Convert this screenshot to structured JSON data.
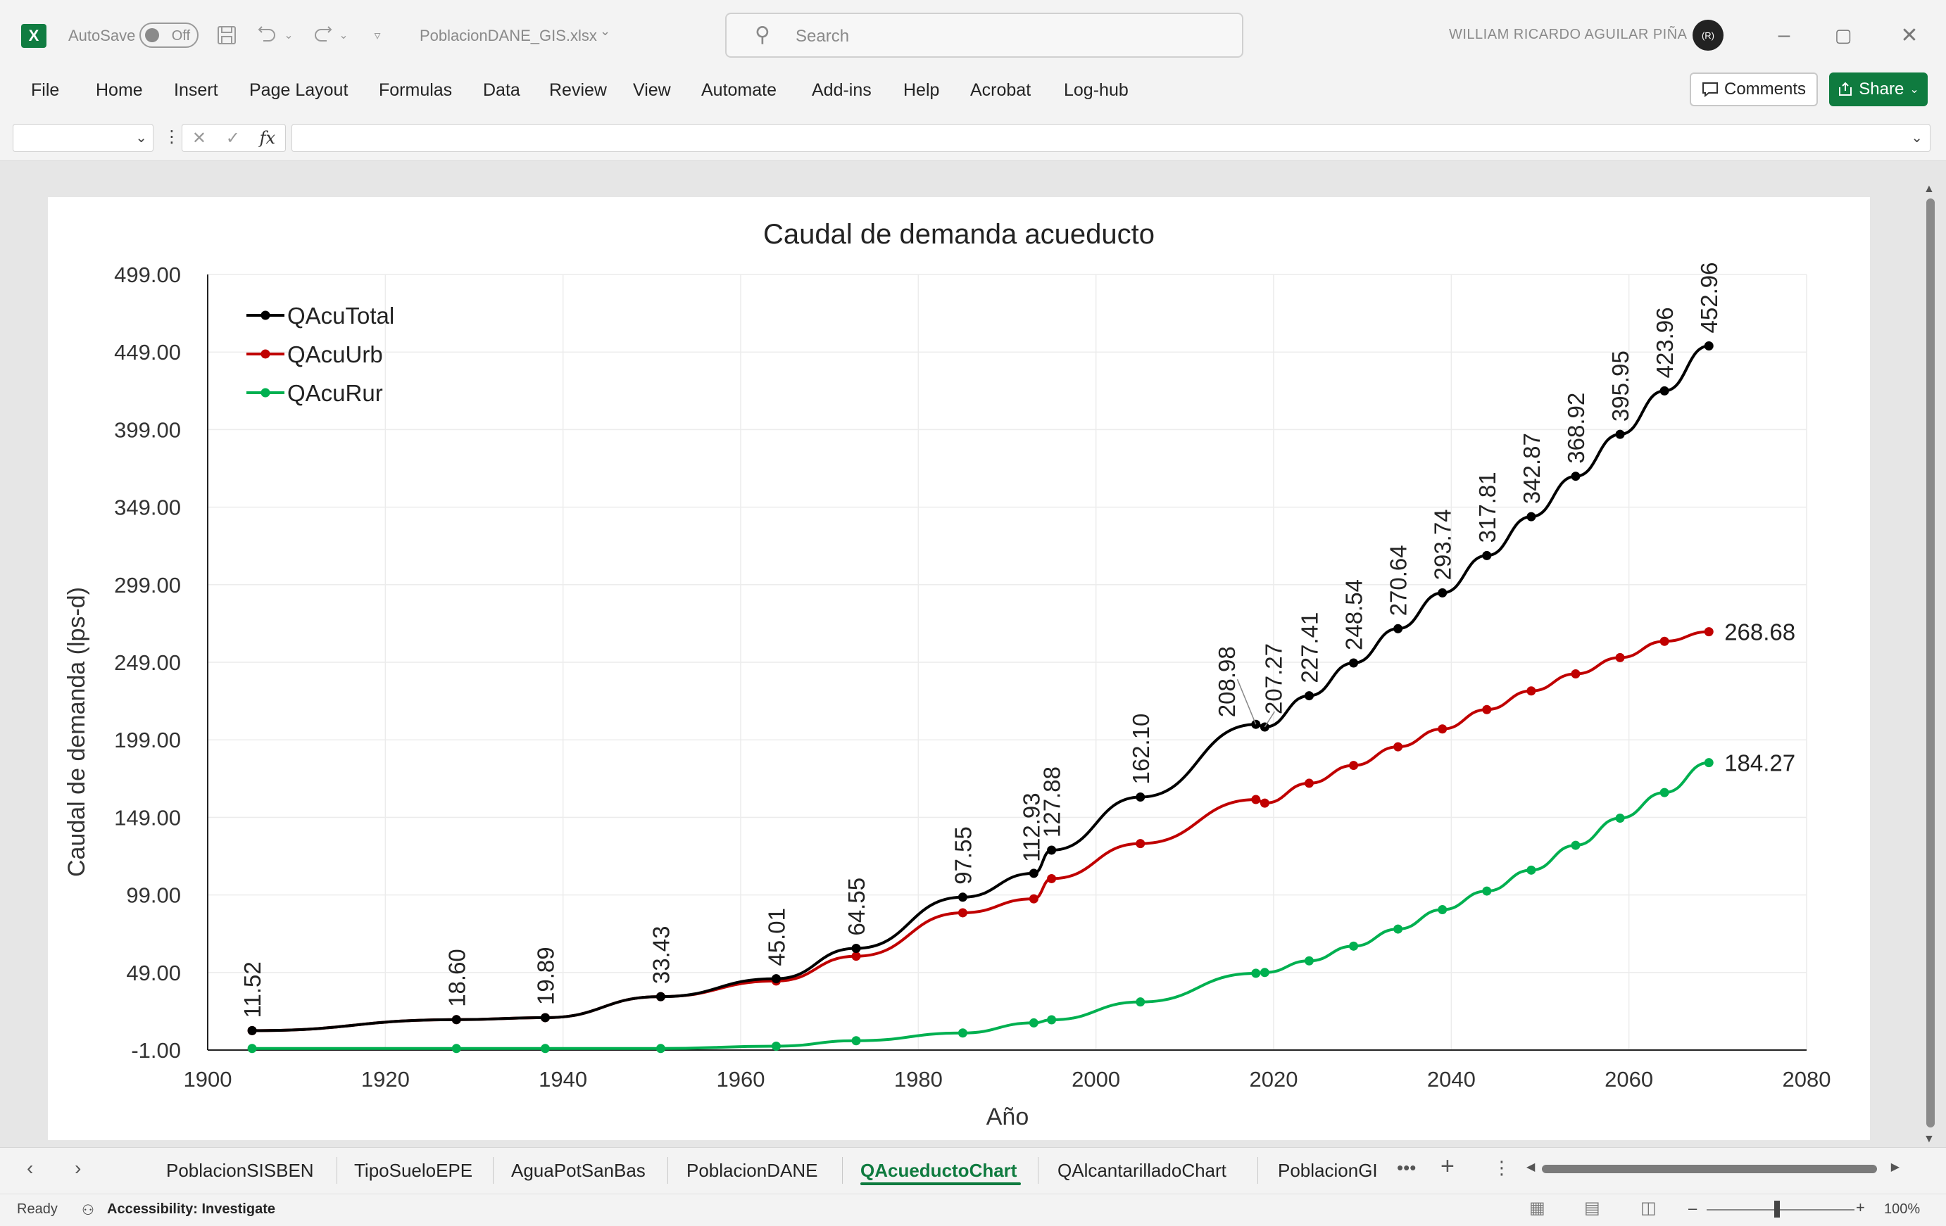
{
  "titlebar": {
    "autosave_label": "AutoSave",
    "autosave_state": "Off",
    "filename": "PoblacionDANE_GIS.xlsx",
    "search_placeholder": "Search",
    "username": "WILLIAM RICARDO AGUILAR PIÑA",
    "avatar_initials": "(R)"
  },
  "menu": {
    "items": [
      "File",
      "Home",
      "Insert",
      "Page Layout",
      "Formulas",
      "Data",
      "Review",
      "View",
      "Automate",
      "Add-ins",
      "Help",
      "Acrobat",
      "Log-hub"
    ],
    "comments_label": "Comments",
    "share_label": "Share"
  },
  "formulabar": {
    "fx_label": "fx"
  },
  "chart_data": {
    "type": "line",
    "title": "Caudal de demanda acueducto",
    "xlabel": "Año",
    "ylabel": "Caudal de demanda (lps-d)",
    "xlim": [
      1900,
      2080
    ],
    "ylim": [
      -1,
      499
    ],
    "xticks": [
      "1900",
      "1920",
      "1940",
      "1960",
      "1980",
      "2000",
      "2020",
      "2040",
      "2060",
      "2080"
    ],
    "yticks": [
      "-1.00",
      "49.00",
      "99.00",
      "149.00",
      "199.00",
      "249.00",
      "299.00",
      "349.00",
      "399.00",
      "449.00",
      "499.00"
    ],
    "grid": true,
    "legend_position": "top-left",
    "series": [
      {
        "name": "QAcuTotal",
        "color": "#000000",
        "x": [
          1905,
          1928,
          1938,
          1951,
          1964,
          1973,
          1985,
          1993,
          1995,
          2005,
          2018,
          2019,
          2024,
          2029,
          2034,
          2039,
          2044,
          2049,
          2054,
          2059,
          2064,
          2069
        ],
        "y": [
          11.52,
          18.6,
          19.89,
          33.43,
          45.01,
          64.55,
          97.55,
          112.93,
          127.88,
          162.1,
          208.98,
          207.27,
          227.41,
          248.54,
          270.64,
          293.74,
          317.81,
          342.87,
          368.92,
          395.95,
          423.96,
          452.96
        ],
        "labels": [
          "11.52",
          "18.60",
          "19.89",
          "33.43",
          "45.01",
          "64.55",
          "97.55",
          "112.93",
          "127.88",
          "162.10",
          "208.98",
          "207.27",
          "227.41",
          "248.54",
          "270.64",
          "293.74",
          "317.81",
          "342.87",
          "368.92",
          "395.95",
          "423.96",
          "452.96"
        ]
      },
      {
        "name": "QAcuUrb",
        "color": "#c00000",
        "x": [
          1905,
          1928,
          1938,
          1951,
          1964,
          1973,
          1985,
          1993,
          1995,
          2005,
          2018,
          2019,
          2024,
          2029,
          2034,
          2039,
          2044,
          2049,
          2054,
          2059,
          2064,
          2069
        ],
        "y": [
          11.52,
          18.6,
          19.89,
          33.43,
          43.5,
          59.5,
          87.5,
          96.5,
          109.5,
          132.1,
          160.5,
          158.2,
          171.0,
          182.5,
          194.5,
          206.0,
          218.5,
          230.5,
          241.5,
          252.0,
          262.5,
          268.68
        ],
        "labels": [
          "268.68"
        ]
      },
      {
        "name": "QAcuRur",
        "color": "#00b050",
        "x": [
          1905,
          1928,
          1938,
          1951,
          1964,
          1973,
          1985,
          1993,
          1995,
          2005,
          2018,
          2019,
          2024,
          2029,
          2034,
          2039,
          2044,
          2049,
          2054,
          2059,
          2064,
          2069
        ],
        "y": [
          0,
          0,
          0,
          0,
          1.5,
          5.0,
          10.0,
          16.5,
          18.5,
          30.0,
          48.5,
          49.0,
          56.5,
          66.0,
          77.0,
          89.5,
          101.5,
          115.0,
          131.0,
          148.5,
          165.0,
          184.27
        ],
        "labels": [
          "184.27"
        ]
      }
    ]
  },
  "sheet_tabs": {
    "tabs": [
      "PoblacionSISBEN",
      "TipoSueloEPE",
      "AguaPotSanBas",
      "PoblacionDANE",
      "QAcueductoChart",
      "QAlcantarilladoChart",
      "PoblacionGI"
    ],
    "active": "QAcueductoChart"
  },
  "status": {
    "ready": "Ready",
    "accessibility": "Accessibility: Investigate",
    "zoom": "100%"
  }
}
